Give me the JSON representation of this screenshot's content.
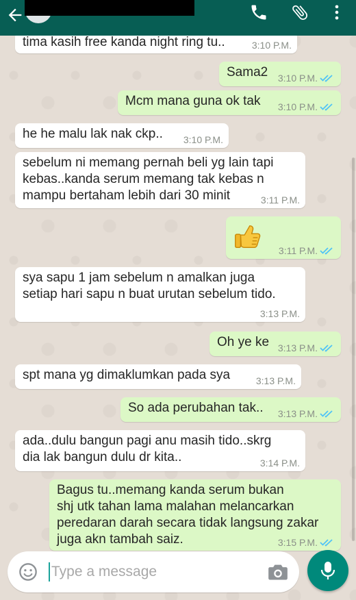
{
  "header": {
    "back_icon": "arrow-left-icon",
    "call_icon": "phone-icon",
    "attach_icon": "paperclip-icon",
    "menu_icon": "more-vert-icon",
    "bar_color": "#075e54"
  },
  "messages": [
    {
      "dir": "in",
      "text": "tima kasih free kanda night ring tu..",
      "time": "3:10 P.M."
    },
    {
      "dir": "out",
      "text": "Sama2",
      "time": "3:10 P.M.",
      "ticks": "read"
    },
    {
      "dir": "out",
      "text": "Mcm mana guna ok tak",
      "time": "3:10 P.M.",
      "ticks": "read"
    },
    {
      "dir": "in",
      "text": "he he malu lak nak ckp..",
      "time": "3:10 P.M."
    },
    {
      "dir": "in",
      "lines": [
        "sebelum ni memang pernah beli yg lain tapi",
        "kebas..kanda serum memang tak kebas n",
        "mampu bertaham lebih dari 30 minit"
      ],
      "time": "3:11 P.M."
    },
    {
      "dir": "out",
      "emoji": "thumbs-up-icon",
      "time": "3:11 P.M.",
      "ticks": "read"
    },
    {
      "dir": "in",
      "lines": [
        "sya sapu 1 jam sebelum n amalkan juga",
        "setiap hari sapu n buat urutan sebelum tido."
      ],
      "time": "3:13 P.M."
    },
    {
      "dir": "out",
      "text": "Oh ye ke",
      "time": "3:13 P.M.",
      "ticks": "read"
    },
    {
      "dir": "in",
      "text": "spt mana yg dimaklumkan pada sya",
      "time": "3:13 P.M."
    },
    {
      "dir": "out",
      "text": "So ada perubahan tak..",
      "time": "3:13 P.M.",
      "ticks": "read"
    },
    {
      "dir": "in",
      "lines": [
        "ada..dulu bangun pagi anu masih tido..skrg",
        "dia lak bangun dulu dr kita.."
      ],
      "time": "3:14 P.M."
    },
    {
      "dir": "out",
      "lines": [
        "Bagus tu..memang kanda serum bukan",
        "shj utk tahan lama malahan melancarkan",
        "peredaran darah secara tidak langsung zakar",
        "juga akn tambah saiz."
      ],
      "time": "3:15 P.M.",
      "ticks": "read"
    }
  ],
  "composer": {
    "placeholder": "Type a message",
    "value": "",
    "emoji_icon": "smiley-icon",
    "camera_icon": "camera-icon",
    "mic_icon": "mic-icon"
  },
  "colors": {
    "incoming_bubble": "#ffffff",
    "outgoing_bubble": "#dcf8c6",
    "read_ticks": "#4fc3f7",
    "mic_button": "#00897b"
  }
}
